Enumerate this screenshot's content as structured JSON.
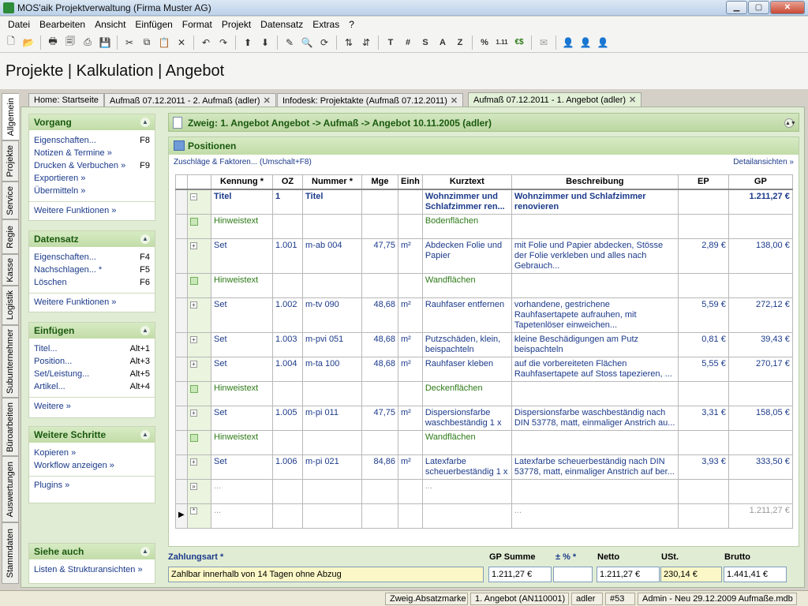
{
  "window": {
    "title": "MOS'aik Projektverwaltung (Firma Muster AG)",
    "min": "▁",
    "max": "▢",
    "close": "✕"
  },
  "menu": [
    "Datei",
    "Bearbeiten",
    "Ansicht",
    "Einfügen",
    "Format",
    "Projekt",
    "Datensatz",
    "Extras",
    "?"
  ],
  "toolbar": {
    "t": "T",
    "hash": "#",
    "s": "S",
    "a": "A",
    "z": "Z",
    "percent": "%",
    "nums": "1.11",
    "euro": "€$"
  },
  "app_title": "Projekte | Kalkulation | Angebot",
  "vtabs": [
    "Allgemein",
    "Projekte",
    "Service",
    "Regie",
    "Kasse",
    "Logistik",
    "Subunternehmer",
    "Büroarbeiten",
    "Auswertungen",
    "Stammdaten"
  ],
  "tabs": [
    "Home: Startseite",
    "Aufmaß 07.12.2011 - 2. Aufmaß (adler)",
    "Infodesk: Projektakte (Aufmaß 07.12.2011)",
    "Aufmaß 07.12.2011 - 1. Angebot (adler)"
  ],
  "tab_close": "✕",
  "sidebar": {
    "vorgang": {
      "title": "Vorgang",
      "items": [
        {
          "label": "Eigenschaften...",
          "key": "F8"
        },
        {
          "label": "Notizen & Termine »",
          "key": ""
        },
        {
          "label": "Drucken & Verbuchen »",
          "key": "F9"
        },
        {
          "label": "Exportieren »",
          "key": ""
        },
        {
          "label": "Übermitteln »",
          "key": ""
        }
      ],
      "more": "Weitere Funktionen »"
    },
    "datensatz": {
      "title": "Datensatz",
      "items": [
        {
          "label": "Eigenschaften...",
          "key": "F4"
        },
        {
          "label": "Nachschlagen... *",
          "key": "F5"
        },
        {
          "label": "Löschen",
          "key": "F6"
        }
      ],
      "more": "Weitere Funktionen »"
    },
    "einfuegen": {
      "title": "Einfügen",
      "items": [
        {
          "label": "Titel...",
          "key": "Alt+1"
        },
        {
          "label": "Position...",
          "key": "Alt+3"
        },
        {
          "label": "Set/Leistung...",
          "key": "Alt+5"
        },
        {
          "label": "Artikel...",
          "key": "Alt+4"
        }
      ],
      "more": "Weitere »"
    },
    "schritte": {
      "title": "Weitere Schritte",
      "items": [
        {
          "label": "Kopieren »",
          "key": ""
        },
        {
          "label": "Workflow anzeigen »",
          "key": ""
        }
      ],
      "more": "Plugins »"
    },
    "siehe": {
      "title": "Siehe auch",
      "items": [
        {
          "label": "Listen & Strukturansichten »",
          "key": ""
        }
      ]
    }
  },
  "zweig": "Zweig: 1. Angebot Angebot -> Aufmaß -> Angebot 10.11.2005 (adler)",
  "positionen": {
    "title": "Positionen",
    "link_left": "Zuschläge & Faktoren... (Umschalt+F8)",
    "link_right": "Detailansichten »"
  },
  "columns": [
    "Kennung *",
    "OZ",
    "Nummer *",
    "Mge",
    "Einh",
    "Kurztext",
    "Beschreibung",
    "EP",
    "GP"
  ],
  "rows": [
    {
      "type": "titel",
      "kennung": "Titel",
      "oz": "1",
      "nummer": "Titel",
      "mge": "",
      "einh": "",
      "kurztext": "Wohnzimmer und Schlafzimmer ren...",
      "beschreibung": "Wohnzimmer und Schlafzimmer renovieren",
      "ep": "",
      "gp": "1.211,27 €"
    },
    {
      "type": "hinweis",
      "kennung": "Hinweistext",
      "oz": "",
      "nummer": "",
      "mge": "",
      "einh": "",
      "kurztext": "Bodenflächen",
      "beschreibung": "",
      "ep": "",
      "gp": ""
    },
    {
      "type": "set",
      "kennung": "Set",
      "oz": "1.001",
      "nummer": "m-ab 004",
      "mge": "47,75",
      "einh": "m²",
      "kurztext": "Abdecken Folie und Papier",
      "beschreibung": "mit Folie und Papier abdecken, Stösse der Folie verkleben und alles nach Gebrauch...",
      "ep": "2,89 €",
      "gp": "138,00 €"
    },
    {
      "type": "hinweis",
      "kennung": "Hinweistext",
      "oz": "",
      "nummer": "",
      "mge": "",
      "einh": "",
      "kurztext": "Wandflächen",
      "beschreibung": "",
      "ep": "",
      "gp": ""
    },
    {
      "type": "set",
      "kennung": "Set",
      "oz": "1.002",
      "nummer": "m-tv 090",
      "mge": "48,68",
      "einh": "m²",
      "kurztext": "Rauhfaser entfernen",
      "beschreibung": "vorhandene, gestrichene Rauhfasertapete aufrauhen, mit Tapetenlöser einweichen...",
      "ep": "5,59 €",
      "gp": "272,12 €"
    },
    {
      "type": "set",
      "kennung": "Set",
      "oz": "1.003",
      "nummer": "m-pvi 051",
      "mge": "48,68",
      "einh": "m²",
      "kurztext": "Putzschäden, klein, beispachteln",
      "beschreibung": "kleine Beschädigungen am Putz beispachteln",
      "ep": "0,81 €",
      "gp": "39,43 €"
    },
    {
      "type": "set",
      "kennung": "Set",
      "oz": "1.004",
      "nummer": "m-ta 100",
      "mge": "48,68",
      "einh": "m²",
      "kurztext": "Rauhfaser kleben",
      "beschreibung": "auf die vorbereiteten Flächen Rauhfasertapete auf Stoss tapezieren, ...",
      "ep": "5,55 €",
      "gp": "270,17 €"
    },
    {
      "type": "hinweis",
      "kennung": "Hinweistext",
      "oz": "",
      "nummer": "",
      "mge": "",
      "einh": "",
      "kurztext": "Deckenflächen",
      "beschreibung": "",
      "ep": "",
      "gp": ""
    },
    {
      "type": "set",
      "kennung": "Set",
      "oz": "1.005",
      "nummer": "m-pi 011",
      "mge": "47,75",
      "einh": "m²",
      "kurztext": "Dispersionsfarbe waschbeständig 1 x",
      "beschreibung": "Dispersionsfarbe waschbeständig nach DIN 53778, matt, einmaliger Anstrich au...",
      "ep": "3,31 €",
      "gp": "158,05 €"
    },
    {
      "type": "hinweis",
      "kennung": "Hinweistext",
      "oz": "",
      "nummer": "",
      "mge": "",
      "einh": "",
      "kurztext": "Wandflächen",
      "beschreibung": "",
      "ep": "",
      "gp": ""
    },
    {
      "type": "set",
      "kennung": "Set",
      "oz": "1.006",
      "nummer": "m-pi 021",
      "mge": "84,86",
      "einh": "m²",
      "kurztext": "Latexfarbe scheuerbeständig 1 x",
      "beschreibung": "Latexfarbe scheuerbeständig nach DIN 53778, matt, einmaliger Anstrich auf ber...",
      "ep": "3,93 €",
      "gp": "333,50 €"
    },
    {
      "type": "empty",
      "kennung": "...",
      "oz": "",
      "nummer": "",
      "mge": "",
      "einh": "",
      "kurztext": "...",
      "beschreibung": "",
      "ep": "",
      "gp": ""
    },
    {
      "type": "new",
      "kennung": "...",
      "oz": "",
      "nummer": "",
      "mge": "",
      "einh": "",
      "kurztext": "",
      "beschreibung": "...",
      "ep": "",
      "gp": "1.211,27 €"
    }
  ],
  "footer": {
    "zahlungsart_label": "Zahlungsart *",
    "zahlungsart": "Zahlbar innerhalb von 14 Tagen ohne Abzug",
    "gp_summe_label": "GP Summe",
    "gp_summe": "1.211,27 €",
    "pm_label": "± % *",
    "pm": "",
    "netto_label": "Netto",
    "netto": "1.211,27 €",
    "ust_label": "USt.",
    "ust": "230,14 €",
    "brutto_label": "Brutto",
    "brutto": "1.441,41 €"
  },
  "status": [
    "Zweig.Absatzmarke",
    "1. Angebot (AN110001)",
    "adler",
    "#53",
    "Admin - Neu 29.12.2009 Aufmaße.mdb"
  ]
}
